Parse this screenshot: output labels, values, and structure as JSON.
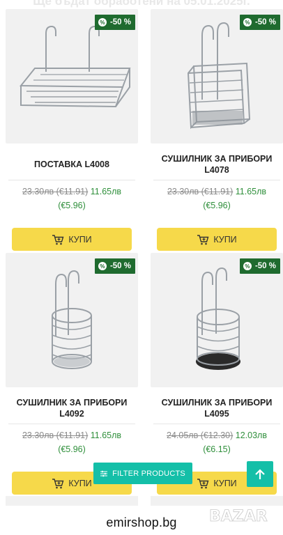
{
  "banner": {
    "text": "Ще бъдат обработени на 05.01.2025г."
  },
  "products": [
    {
      "discount": "-50 %",
      "title": "ПОСТАВКА L4008",
      "old_price": "23.30лв (€11.91)",
      "new_price": "11.65лв",
      "new_price_eur": "(€5.96)",
      "buy_label": "КУПИ",
      "image": "wall-basket-rack"
    },
    {
      "discount": "-50 %",
      "title": "СУШИЛНИК ЗА ПРИБОРИ L4078",
      "old_price": "23.30лв (€11.91)",
      "new_price": "11.65лв",
      "new_price_eur": "(€5.96)",
      "buy_label": "КУПИ",
      "image": "square-cutlery-holder"
    },
    {
      "discount": "-50 %",
      "title": "СУШИЛНИК ЗА ПРИБОРИ L4092",
      "old_price": "23.30лв (€11.91)",
      "new_price": "11.65лв",
      "new_price_eur": "(€5.96)",
      "buy_label": "КУПИ",
      "image": "round-cutlery-holder"
    },
    {
      "discount": "-50 %",
      "title": "СУШИЛНИК ЗА ПРИБОРИ L4095",
      "old_price": "24.05лв (€12.30)",
      "new_price": "12.03лв",
      "new_price_eur": "(€6.15)",
      "buy_label": "КУПИ",
      "image": "round-cutlery-holder-black-tray"
    }
  ],
  "filter_button": {
    "label": "FILTER PRODUCTS",
    "icon": "sliders-icon"
  },
  "scroll_top": {
    "icon": "arrow-up-icon"
  },
  "watermark": {
    "site": "emirshop.bg",
    "logo": "BAZAR"
  },
  "colors": {
    "badge": "#1f6b2f",
    "new_price": "#2f8f3b",
    "buy": "#f6d94a",
    "accent": "#14bfa8"
  }
}
